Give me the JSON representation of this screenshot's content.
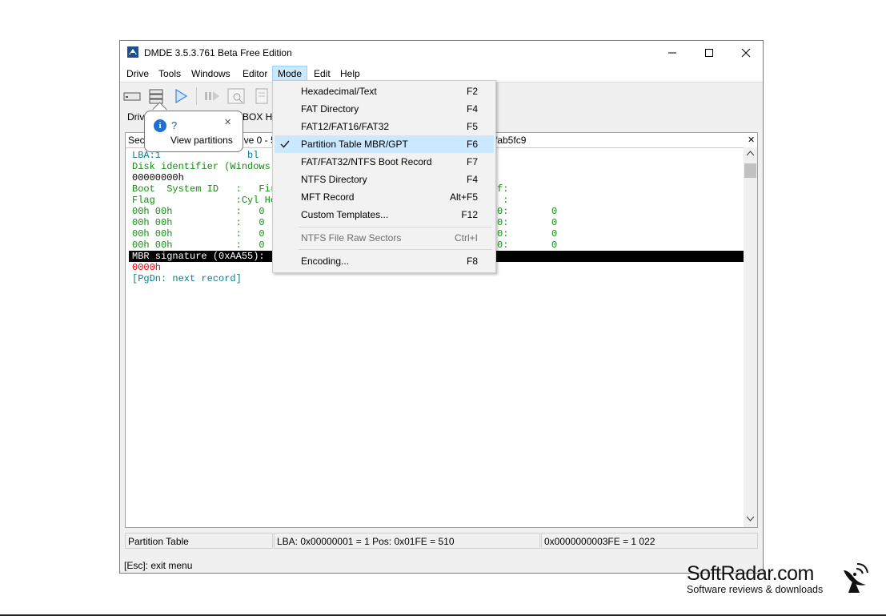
{
  "window": {
    "title": "DMDE 3.5.3.761 Beta Free Edition",
    "controls": {
      "minimize": "—",
      "maximize": "☐",
      "close": "✕"
    }
  },
  "menubar": [
    "Drive",
    "Tools",
    "Windows",
    "Editor",
    "Mode",
    "Edit",
    "Help"
  ],
  "tabs": {
    "drive_label": "Driv",
    "vbox_label": "BOX H..."
  },
  "panel": {
    "header_left": "Sect",
    "header_mid": "ive 0 - 5",
    "header_right": "fab5fc9",
    "close": "✕",
    "lines": [
      {
        "text": "LBA:1               bl",
        "color": "teal"
      },
      {
        "text": "Disk identifier (Windows)",
        "color": "green"
      },
      {
        "text": "00000000h",
        "color": "dk"
      },
      {
        "text": "Boot  System ID   :   Fir",
        "color": "green"
      },
      {
        "text": "Flag              :Cyl He",
        "color": "green"
      },
      {
        "text": "00h 00h           :   0",
        "color": "green"
      },
      {
        "text": "00h 00h           :   0",
        "color": "green"
      },
      {
        "text": "00h 00h           :   0",
        "color": "green"
      },
      {
        "text": "00h 00h           :   0",
        "color": "green"
      }
    ],
    "right_col": [
      {
        "text": "f:",
        "color": "green"
      },
      {
        "text": " :",
        "color": "green"
      },
      {
        "text": "0:",
        "color": "green"
      },
      {
        "text": "0:",
        "color": "green"
      },
      {
        "text": "0:",
        "color": "green"
      },
      {
        "text": "0:",
        "color": "green"
      }
    ],
    "zeros": [
      "0",
      "0",
      "0",
      "0"
    ],
    "signature": "MBR signature (0xAA55):",
    "sig_value": "0000h",
    "next": "[PgDn: next record]"
  },
  "status": {
    "left": "Partition Table",
    "mid": "LBA: 0x00000001 = 1  Pos: 0x01FE = 510",
    "right": "0x0000000003FE = 1 022"
  },
  "esc_hint": "[Esc]: exit menu",
  "tooltip": {
    "title": "?",
    "text": "View partitions",
    "close": "✕"
  },
  "mode_menu": {
    "items": [
      {
        "label": "Hexadecimal/Text",
        "key": "F2"
      },
      {
        "label": "FAT Directory",
        "key": "F4"
      },
      {
        "label": "FAT12/FAT16/FAT32",
        "key": "F5"
      },
      {
        "label": "Partition Table MBR/GPT",
        "key": "F6",
        "checked": true
      },
      {
        "label": "FAT/FAT32/NTFS Boot Record",
        "key": "F7"
      },
      {
        "label": "NTFS Directory",
        "key": "F4"
      },
      {
        "label": "MFT Record",
        "key": "Alt+F5"
      },
      {
        "label": "Custom Templates...",
        "key": "F12"
      },
      {
        "label": "NTFS File Raw Sectors",
        "key": "Ctrl+I",
        "disabled": true
      },
      {
        "label": "Encoding...",
        "key": "F8"
      }
    ]
  },
  "brand": {
    "name": "SoftRadar.com",
    "tagline": "Software reviews & downloads"
  }
}
